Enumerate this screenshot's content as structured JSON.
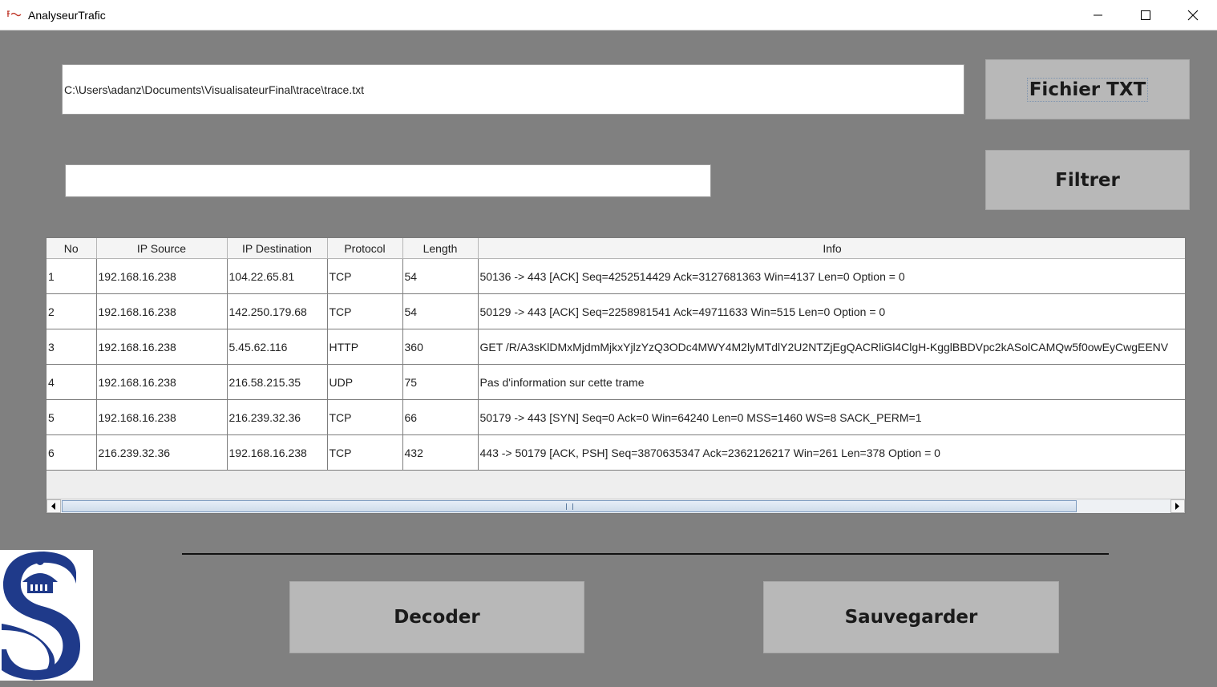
{
  "window": {
    "title": "AnalyseurTrafic"
  },
  "file_path": {
    "value": "C:\\Users\\adanz\\Documents\\VisualisateurFinal\\trace\\trace.txt"
  },
  "filter": {
    "value": ""
  },
  "buttons": {
    "open_file": "Fichier TXT",
    "filter": "Filtrer",
    "decode": "Decoder",
    "save": "Sauvegarder"
  },
  "table": {
    "columns": [
      "No",
      "IP Source",
      "IP Destination",
      "Protocol",
      "Length",
      "Info"
    ],
    "rows": [
      [
        "1",
        "192.168.16.238",
        "104.22.65.81",
        "TCP",
        "54",
        "50136 -> 443 [ACK] Seq=4252514429 Ack=3127681363 Win=4137 Len=0 Option = 0"
      ],
      [
        "2",
        "192.168.16.238",
        "142.250.179.68",
        "TCP",
        "54",
        "50129 -> 443 [ACK] Seq=2258981541 Ack=49711633 Win=515 Len=0 Option = 0"
      ],
      [
        "3",
        "192.168.16.238",
        "5.45.62.116",
        "HTTP",
        "360",
        "GET /R/A3sKlDMxMjdmMjkxYjlzYzQ3ODc4MWY4M2lyMTdlY2U2NTZjEgQACRliGl4ClgH-KgglBBDVpc2kASolCAMQw5f0owEyCwgEENV"
      ],
      [
        "4",
        "192.168.16.238",
        "216.58.215.35",
        "UDP",
        "75",
        "Pas d'information sur cette trame"
      ],
      [
        "5",
        "192.168.16.238",
        "216.239.32.36",
        "TCP",
        "66",
        "50179 -> 443 [SYN] Seq=0 Ack=0 Win=64240 Len=0 MSS=1460 WS=8 SACK_PERM=1"
      ],
      [
        "6",
        "216.239.32.36",
        "192.168.16.238",
        "TCP",
        "432",
        "443 -> 50179 [ACK, PSH] Seq=3870635347 Ack=2362126217 Win=261 Len=378 Option = 0"
      ]
    ]
  },
  "colors": {
    "background": "#808080",
    "button": "#b8b8b8",
    "logo_blue": "#1f3a8a"
  },
  "icons": [
    "app-icon",
    "minimize-icon",
    "maximize-icon",
    "close-icon",
    "arrow-left-icon",
    "arrow-right-icon",
    "university-logo"
  ]
}
